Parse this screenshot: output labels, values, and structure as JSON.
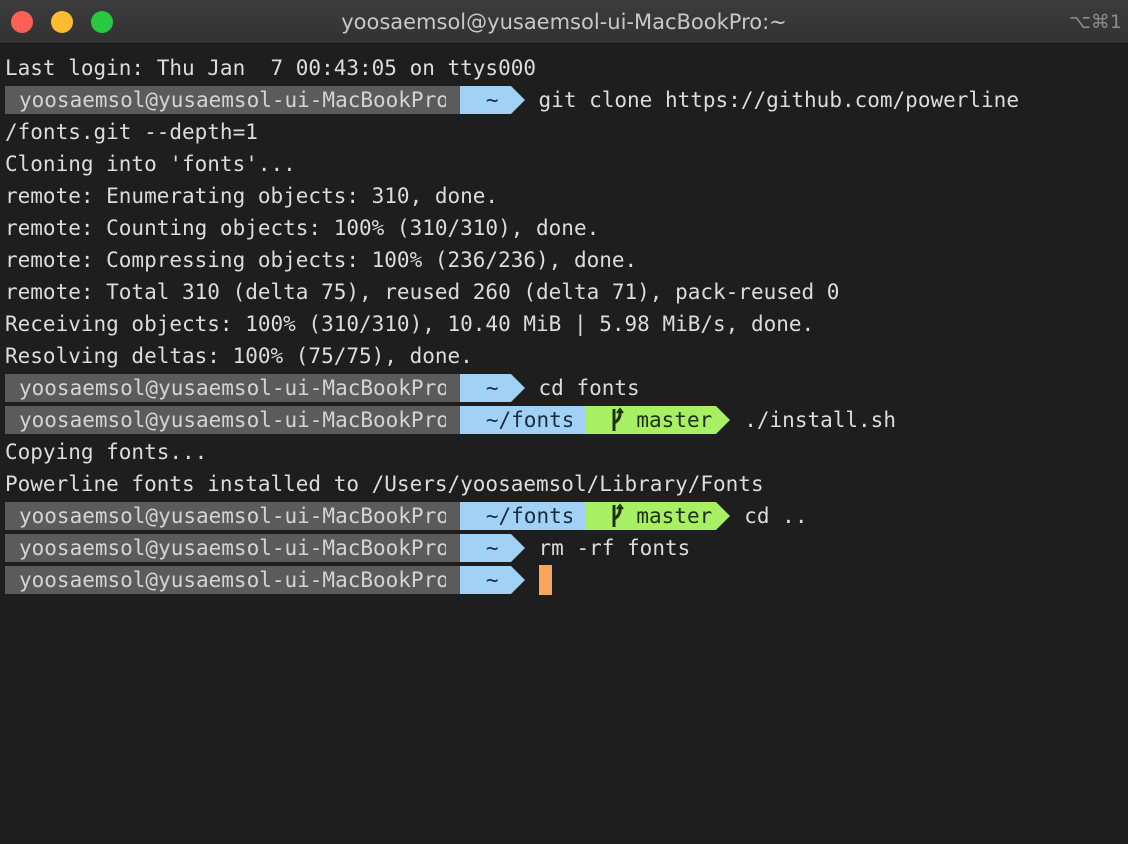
{
  "window": {
    "title": "yoosaemsol@yusaemsol-ui-MacBookPro:~",
    "shortcut": "⌥⌘1"
  },
  "prompt": {
    "user": "yoosaemsol@yusaemsol-ui-MacBookPro",
    "home": "~",
    "fonts_dir": "~/fonts",
    "branch": "master"
  },
  "output": {
    "last_login": "Last login: Thu Jan  7 00:43:05 on ttys000",
    "cmd_clone": "git clone https://github.com/powerline",
    "clone_wrap": "/fonts.git --depth=1",
    "cloning": "Cloning into 'fonts'...",
    "enumerating": "remote: Enumerating objects: 310, done.",
    "counting": "remote: Counting objects: 100% (310/310), done.",
    "compressing": "remote: Compressing objects: 100% (236/236), done.",
    "total": "remote: Total 310 (delta 75), reused 260 (delta 71), pack-reused 0",
    "receiving": "Receiving objects: 100% (310/310), 10.40 MiB | 5.98 MiB/s, done.",
    "resolving": "Resolving deltas: 100% (75/75), done.",
    "cmd_cd_fonts": "cd fonts",
    "cmd_install": "./install.sh",
    "copying": "Copying fonts...",
    "installed": "Powerline fonts installed to /Users/yoosaemsol/Library/Fonts",
    "cmd_cd_up": "cd ..",
    "cmd_rm": "rm -rf fonts"
  },
  "colors": {
    "background": "#1e1e1e",
    "user_segment": "#5b5b5b",
    "dir_segment": "#a2d1f6",
    "git_segment": "#a7ef63",
    "cursor": "#f9a55b"
  }
}
